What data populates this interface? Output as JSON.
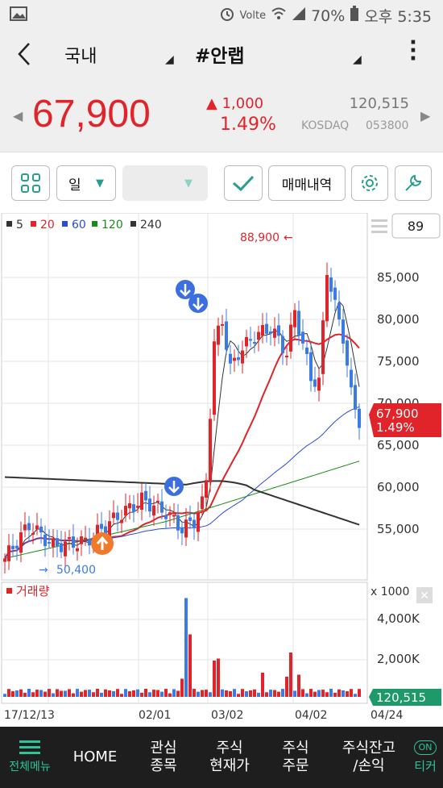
{
  "status_bar": {
    "battery": "70%",
    "time": "오후 5:35",
    "network": "Volte"
  },
  "header": {
    "market": "국내",
    "stock_name": "#안랩"
  },
  "quote": {
    "price": "67,900",
    "change": "1,000",
    "change_pct": "1.49%",
    "volume": "120,515",
    "market": "KOSDAQ",
    "code": "053800"
  },
  "toolbar": {
    "period": "일",
    "trade_history": "매매내역"
  },
  "chart_legend": [
    {
      "label": "5",
      "color": "#333333"
    },
    {
      "label": "20",
      "color": "#e0242a"
    },
    {
      "label": "60",
      "color": "#2a4bd8"
    },
    {
      "label": "120",
      "color": "#1a8a1a"
    },
    {
      "label": "240",
      "color": "#333333"
    }
  ],
  "chart_count": "89",
  "price_axis": [
    "85,000",
    "80,000",
    "75,000",
    "70,000",
    "65,000",
    "60,000",
    "55,000"
  ],
  "high_label": "88,900",
  "low_label": "50,400",
  "current_label": {
    "price": "67,900",
    "pct": "1.49%"
  },
  "volume_title": "거래량",
  "volume_unit": "x 1000",
  "volume_axis": [
    "4,000K",
    "2,000K"
  ],
  "volume_label": "120,515",
  "date_axis": [
    "17/12/13",
    "02/01",
    "03/02",
    "04/02",
    "04/24"
  ],
  "chart_data": {
    "type": "candlestick",
    "ylim": [
      50000,
      90000
    ],
    "high": 88900,
    "low": 50400,
    "last": 67900,
    "moving_averages": [
      "5",
      "20",
      "60",
      "120",
      "240"
    ],
    "volume_ylim": [
      0,
      5000
    ],
    "volume_unit": "x 1000"
  },
  "bottom_nav": [
    {
      "label": "전체메뉴"
    },
    {
      "label": "HOME"
    },
    {
      "label": "관심\n종목"
    },
    {
      "label": "주식\n현재가"
    },
    {
      "label": "주식\n주문"
    },
    {
      "label": "주식잔고\n/손익"
    },
    {
      "label": "티커",
      "badge": "ON"
    }
  ],
  "colors": {
    "up": "#e0242a",
    "down": "#3b7be8",
    "accent": "#2a9d8f"
  }
}
